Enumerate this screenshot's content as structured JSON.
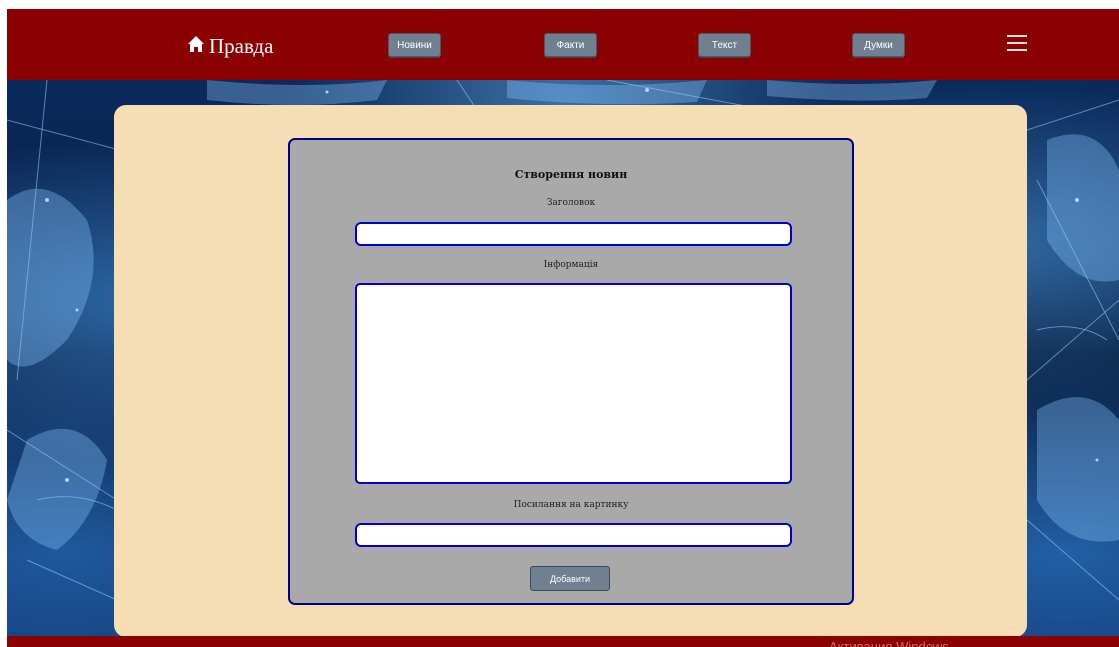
{
  "header": {
    "brand": "Правда",
    "nav": [
      "Новини",
      "Факти",
      "Текст",
      "Думки"
    ]
  },
  "form": {
    "title": "Створення новин",
    "title_label": "Заголовок",
    "title_value": "",
    "info_label": "Інформація",
    "info_value": "",
    "image_label": "Посилання на картинку",
    "image_value": "",
    "submit": "Добавити"
  },
  "system": {
    "watermark": "Активация Windows"
  },
  "colors": {
    "header": "#8b0000",
    "panel": "#f5deb3",
    "card": "#a9a9a9",
    "card_border": "#00008b",
    "button": "#708090"
  }
}
